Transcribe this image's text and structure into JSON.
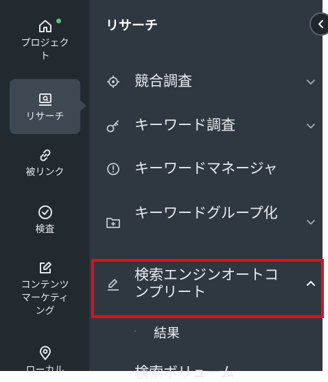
{
  "rail": {
    "items": [
      {
        "label": "プロジェクト",
        "icon": "home-icon"
      },
      {
        "label": "リサーチ",
        "icon": "research-icon"
      },
      {
        "label": "被リンク",
        "icon": "link-icon"
      },
      {
        "label": "検査",
        "icon": "check-circle-icon"
      },
      {
        "label": "コンテンツマーケティング",
        "icon": "pencil-square-icon"
      },
      {
        "label": "ローカル",
        "icon": "map-pin-icon"
      }
    ]
  },
  "panel": {
    "title": "リサーチ",
    "items": [
      {
        "label": "競合調査",
        "icon": "target-icon",
        "chevron": "down"
      },
      {
        "label": "キーワード調査",
        "icon": "key-icon",
        "chevron": "down"
      },
      {
        "label": "キーワードマネージャ",
        "icon": "info-circle-icon",
        "chevron": "none"
      },
      {
        "label": "キーワードグループ化",
        "icon": "folder-plus-icon",
        "chevron": "down"
      },
      {
        "label": "検索エンジンオートコンプリート",
        "icon": "edit-icon",
        "chevron": "up"
      }
    ],
    "sub_items": [
      {
        "label": "結果"
      }
    ],
    "next_item": {
      "label": "検索ボリューム"
    }
  },
  "colors": {
    "rail_bg": "#22292f",
    "panel_bg": "#2f3841",
    "active_bg": "#3d4852",
    "highlight": "#e0101a",
    "status_dot": "#5fbf7c"
  }
}
